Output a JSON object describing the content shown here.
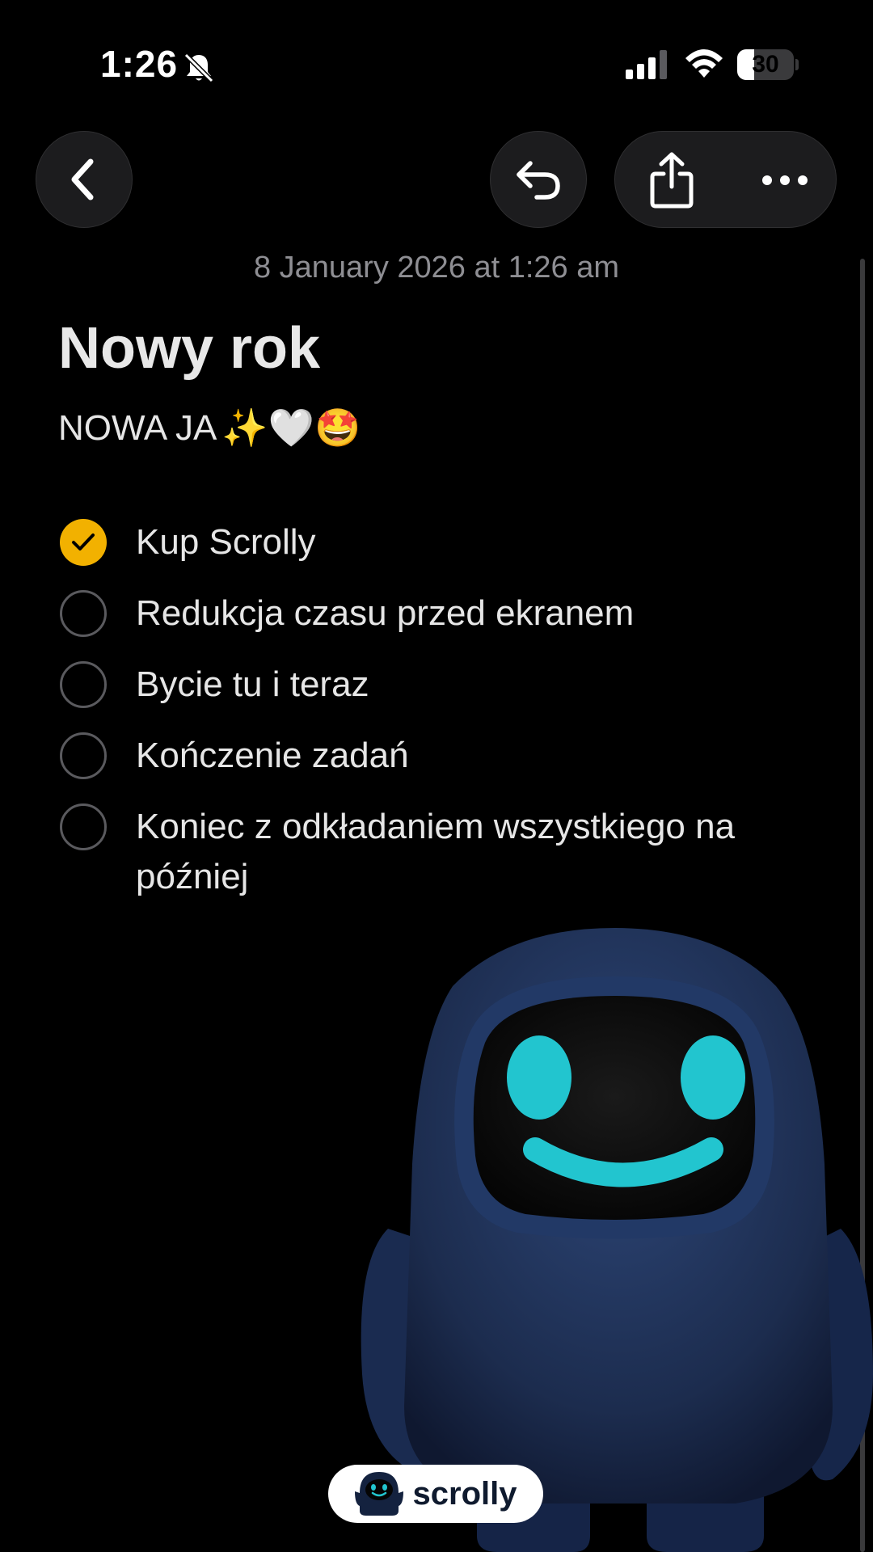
{
  "status_bar": {
    "time": "1:26",
    "battery_level": "30",
    "battery_fraction": 0.3
  },
  "toolbar": {
    "back_icon": "chevron-left-icon",
    "undo_icon": "undo-icon",
    "share_icon": "share-icon",
    "more_icon": "more-icon"
  },
  "note": {
    "date": "8 January 2026 at 1:26 am",
    "title": "Nowy rok",
    "subtitle_text": "NOWA JA",
    "subtitle_emojis": "✨🤍🤩",
    "checklist": [
      {
        "text": "Kup Scrolly",
        "checked": true
      },
      {
        "text": "Redukcja czasu przed ekranem",
        "checked": false
      },
      {
        "text": "Bycie tu i teraz",
        "checked": false
      },
      {
        "text": "Kończenie zadań",
        "checked": false
      },
      {
        "text": "Koniec z odkładaniem wszystkiego na później",
        "checked": false
      }
    ]
  },
  "brand": {
    "name": "scrolly"
  },
  "colors": {
    "accent": "#f2b100",
    "mascot_body": "#1f3257",
    "mascot_face": "#22c5cf"
  }
}
